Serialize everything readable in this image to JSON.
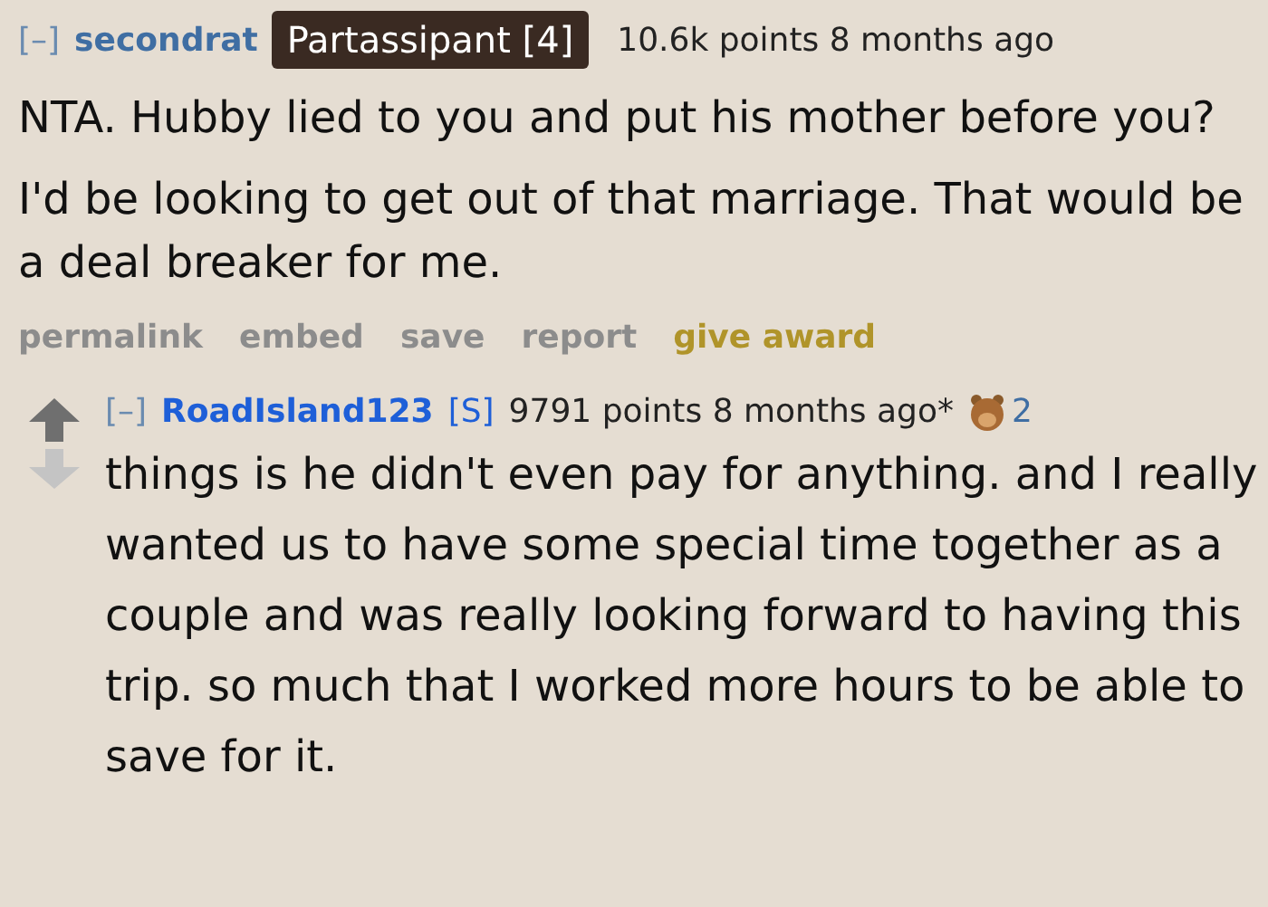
{
  "comment": {
    "collapse": "[–]",
    "author": "secondrat",
    "flair": "Partassipant [4]",
    "meta": "10.6k points 8 months ago",
    "paragraphs": [
      "NTA. Hubby lied to you and put his mother before you?",
      "I'd be looking to get out of that marriage. That would be a deal breaker for me."
    ],
    "actions": [
      {
        "label": "permalink",
        "kind": "plain"
      },
      {
        "label": "embed",
        "kind": "plain"
      },
      {
        "label": "save",
        "kind": "plain"
      },
      {
        "label": "report",
        "kind": "plain"
      },
      {
        "label": "give award",
        "kind": "award"
      }
    ]
  },
  "reply": {
    "collapse": "[–]",
    "author": "RoadIsland123",
    "submitter": "[S]",
    "meta": "9791 points 8 months ago*",
    "award_count": "2",
    "body": "things is he didn't even pay for anything. and I really wanted us to have some special time together as a couple and was really looking forward to having this trip. so much that I worked more hours to be able to save for it."
  }
}
